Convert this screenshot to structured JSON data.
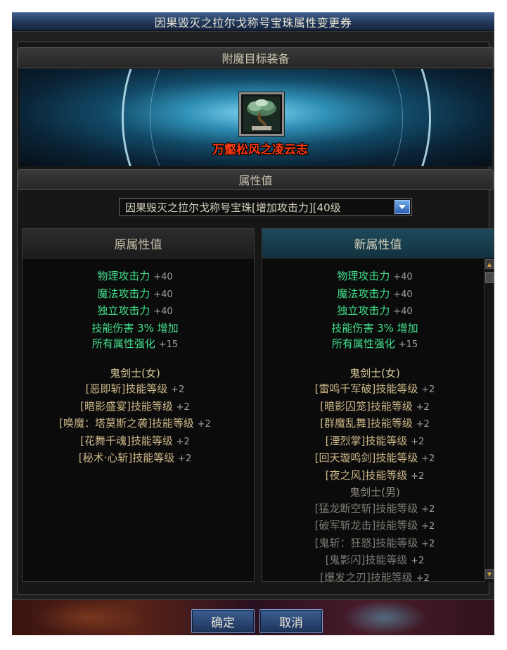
{
  "window": {
    "title": "因果毁灭之拉尔戈称号宝珠属性变更券"
  },
  "target_section": {
    "header": "附魔目标装备",
    "item_name": "万壑松风之凌云志",
    "item_icon": "bonsai-pine-icon"
  },
  "attr_section": {
    "header": "属性值",
    "select_value": "因果毁灭之拉尔戈称号宝珠[增加攻击力][40级"
  },
  "original": {
    "title": "原属性值",
    "stats": [
      {
        "name": "物理攻击力",
        "value": "+40"
      },
      {
        "name": "魔法攻击力",
        "value": "+40"
      },
      {
        "name": "独立攻击力",
        "value": "+40"
      },
      {
        "name": "技能伤害",
        "value": "3% 增加"
      },
      {
        "name": "所有属性强化",
        "value": "+15"
      }
    ],
    "class_name": "鬼剑士(女)",
    "skills": [
      {
        "name": "[恶即斩]技能等级",
        "value": "+2"
      },
      {
        "name": "[暗影盛宴]技能等级",
        "value": "+2"
      },
      {
        "name": "[唤魔：塔莫斯之袭]技能等级",
        "value": "+2"
      },
      {
        "name": "[花舞千魂]技能等级",
        "value": "+2"
      },
      {
        "name": "[秘术·心斩]技能等级",
        "value": "+2"
      }
    ]
  },
  "new": {
    "title": "新属性值",
    "stats": [
      {
        "name": "物理攻击力",
        "value": "+40"
      },
      {
        "name": "魔法攻击力",
        "value": "+40"
      },
      {
        "name": "独立攻击力",
        "value": "+40"
      },
      {
        "name": "技能伤害",
        "value": "3% 增加"
      },
      {
        "name": "所有属性强化",
        "value": "+15"
      }
    ],
    "class_name": "鬼剑士(女)",
    "skills": [
      {
        "name": "[雷鸣千军破]技能等级",
        "value": "+2"
      },
      {
        "name": "[暗影囚笼]技能等级",
        "value": "+2"
      },
      {
        "name": "[群魔乱舞]技能等级",
        "value": "+2"
      },
      {
        "name": "[湮烈掌]技能等级",
        "value": "+2"
      },
      {
        "name": "[回天璇鸣剑]技能等级",
        "value": "+2"
      },
      {
        "name": "[夜之风]技能等级",
        "value": "+2"
      }
    ],
    "class_name_2": "鬼剑士(男)",
    "skills_2": [
      {
        "name": "[猛龙断空斩]技能等级",
        "value": "+2"
      },
      {
        "name": "[破军斩龙击]技能等级",
        "value": "+2"
      },
      {
        "name": "[鬼斩：狂怒]技能等级",
        "value": "+2"
      },
      {
        "name": "[鬼影闪]技能等级",
        "value": "+2"
      },
      {
        "name": "[爆发之刃]技能等级",
        "value": "+2"
      }
    ]
  },
  "buttons": {
    "ok": "确定",
    "cancel": "取消"
  }
}
